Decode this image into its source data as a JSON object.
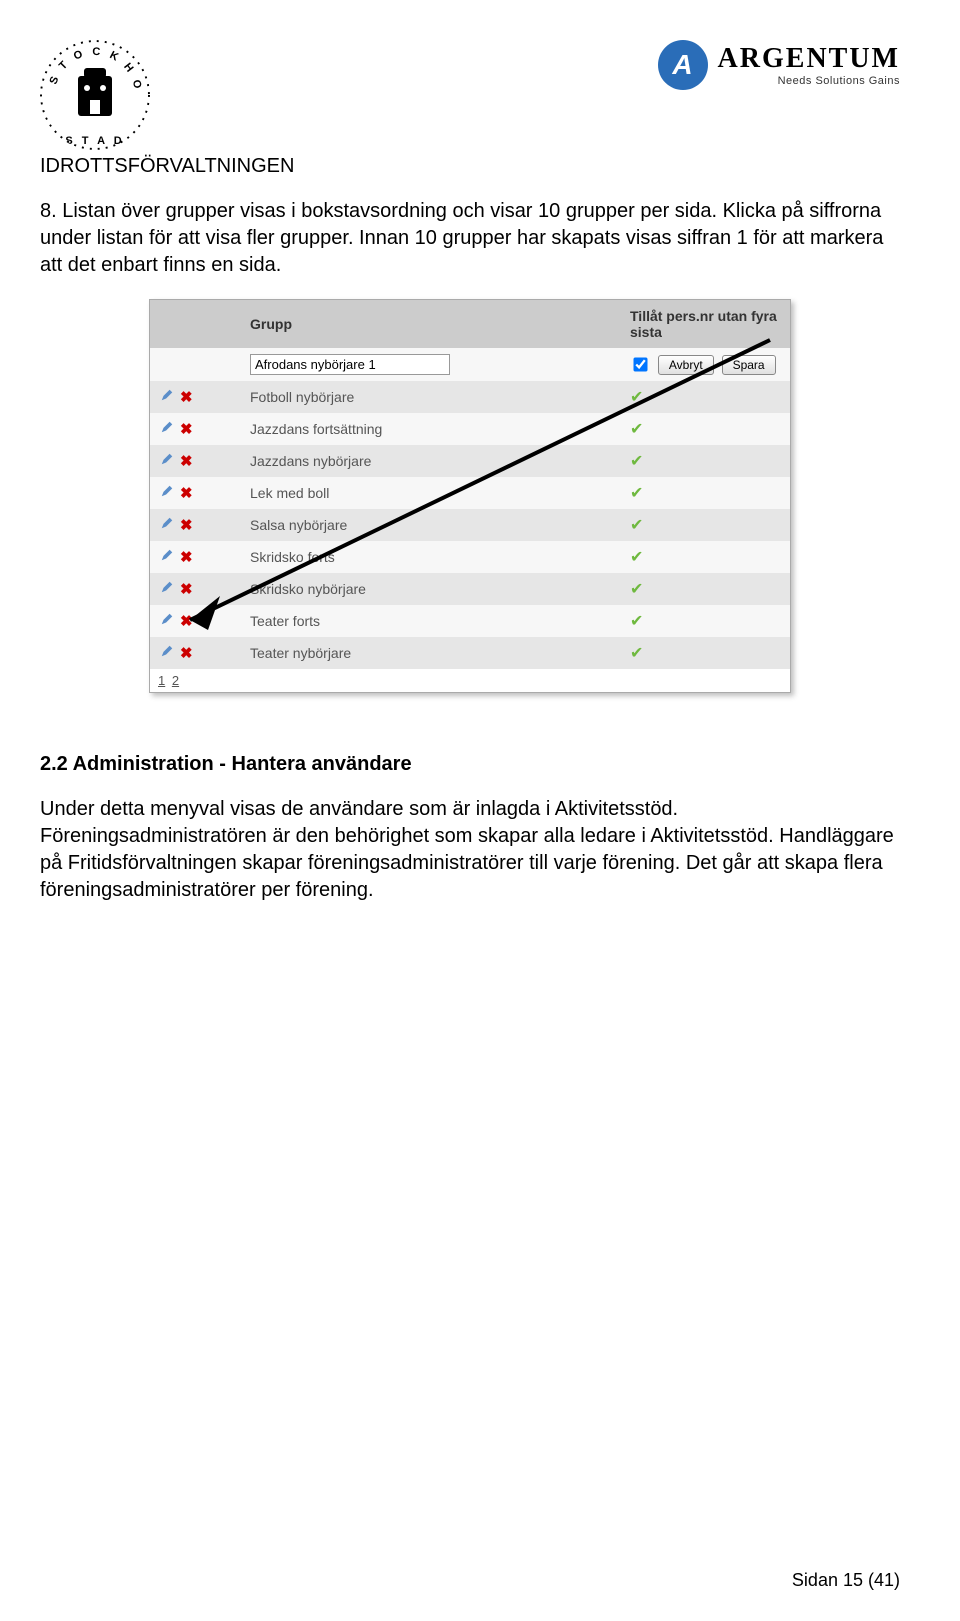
{
  "header": {
    "dept": "IDROTTSFÖRVALTNINGEN",
    "brand": "ARGENTUM",
    "brand_logo_letter": "A",
    "brand_tag": "Needs Solutions Gains"
  },
  "intro_text": "8. Listan över grupper visas i bokstavsordning och visar 10 grupper per sida. Klicka på siffrorna under listan för att visa fler grupper. Innan 10 grupper har skapats visas siffran 1 för att markera att det enbart finns en sida.",
  "table": {
    "col_group": "Grupp",
    "col_allow": "Tillåt pers.nr utan fyra sista",
    "edit_value": "Afrodans nybörjare 1",
    "btn_cancel": "Avbryt",
    "btn_save": "Spara",
    "rows": [
      "Fotboll nybörjare",
      "Jazzdans fortsättning",
      "Jazzdans nybörjare",
      "Lek med boll",
      "Salsa nybörjare",
      "Skridsko forts",
      "Skridsko nybörjare",
      "Teater forts",
      "Teater nybörjare"
    ],
    "page1": "1",
    "page2": "2"
  },
  "section": {
    "heading": "2.2 Administration - Hantera användare",
    "para": "Under detta menyval visas de användare som är inlagda i Aktivitetsstöd. Föreningsadministratören är den behörighet som skapar alla ledare i Aktivitetsstöd. Handläggare på Fritidsförvaltningen skapar föreningsadministratörer till varje förening. Det går att skapa flera föreningsadministratörer per förening."
  },
  "footer": "Sidan 15 (41)"
}
